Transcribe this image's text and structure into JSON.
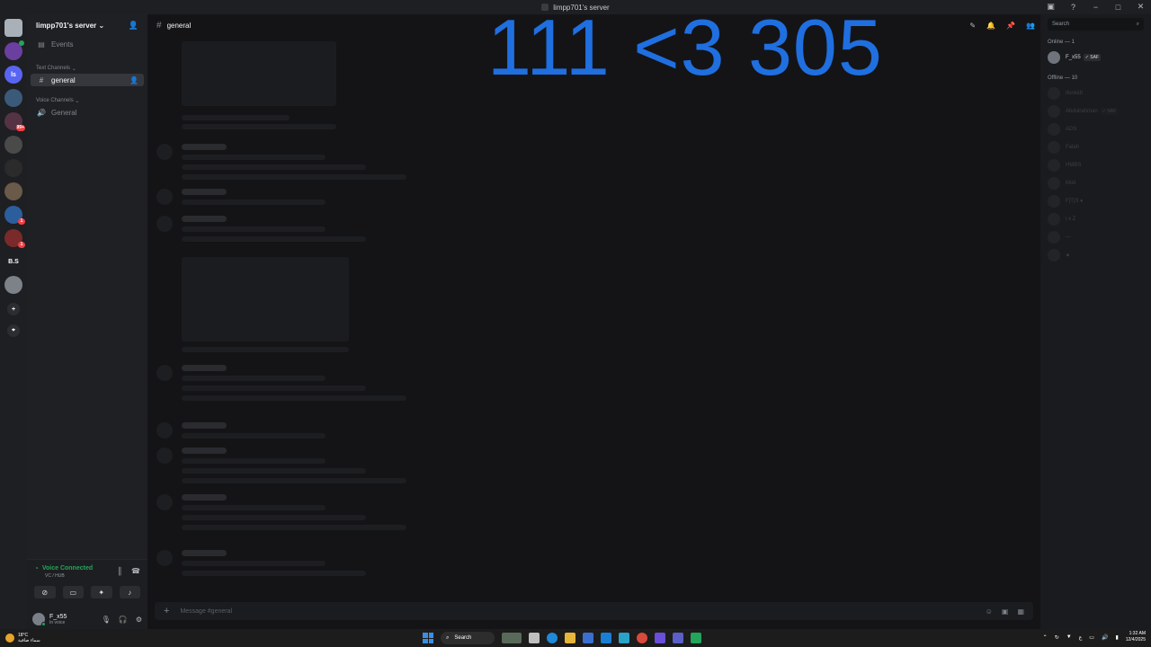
{
  "window": {
    "title": "limpp701's server",
    "controls": [
      "−",
      "□",
      "✕"
    ]
  },
  "overlay": {
    "text": "111 <3 305",
    "color": "#1f6fe0"
  },
  "guilds": [
    {
      "icon": "guild-icon",
      "color": "#a9b0b8"
    },
    {
      "icon": "guild-icon",
      "color": "#6b3fa0",
      "badge": "",
      "dot": true
    },
    {
      "icon": "guild-icon",
      "color": "#5865f2",
      "label": "ls"
    },
    {
      "icon": "guild-icon",
      "color": "#3b5a7a"
    },
    {
      "icon": "guild-icon",
      "color": "#553344",
      "badge": "99+"
    },
    {
      "icon": "guild-icon",
      "color": "#4a4a4a"
    },
    {
      "icon": "guild-icon",
      "color": "#2b2b2b"
    },
    {
      "icon": "guild-icon",
      "color": "#6a5a4a"
    },
    {
      "icon": "guild-icon",
      "color": "#2c5e9e",
      "badge": "1"
    },
    {
      "icon": "guild-icon",
      "color": "#7a2a2a",
      "badge": "1"
    },
    {
      "icon": "guild-icon",
      "color": "#1e1f22",
      "label": "B.S"
    },
    {
      "icon": "guild-icon",
      "color": "#7d8288"
    }
  ],
  "sidebar": {
    "server_name": "limpp701's server",
    "events_label": "Events",
    "text_category": "Text Channels",
    "text_channels": [
      {
        "name": "general",
        "active": true
      }
    ],
    "voice_category": "Voice Channels",
    "voice_channels": [
      {
        "name": "General"
      }
    ]
  },
  "voice": {
    "status": "Voice Connected",
    "channel": "VC / HUB"
  },
  "user": {
    "name": "F_x55",
    "status": "In voice"
  },
  "channel": {
    "name": "general",
    "composer_placeholder": "Message #general"
  },
  "members": {
    "search_placeholder": "Search",
    "online_header": "Online — 1",
    "online": [
      {
        "name": "F_x55",
        "tag": "✓ SAF"
      }
    ],
    "offline_header": "Offline — 10",
    "offline": [
      {
        "name": "ifonkidt"
      },
      {
        "name": "Abdulrahman",
        "tag": "✓ SAF"
      },
      {
        "name": "ADS"
      },
      {
        "name": "Falah"
      },
      {
        "name": "HMBS"
      },
      {
        "name": "Moli"
      },
      {
        "name": "F|T|S ♦"
      },
      {
        "name": "i x Z"
      },
      {
        "name": "—"
      },
      {
        "name": "⚫"
      }
    ]
  },
  "taskbar": {
    "weather_temp": "18°C",
    "weather_desc": "سماء صافية",
    "search_label": "Search",
    "time": "1:32 AM",
    "date": "12/4/2025",
    "lang": "ع"
  }
}
